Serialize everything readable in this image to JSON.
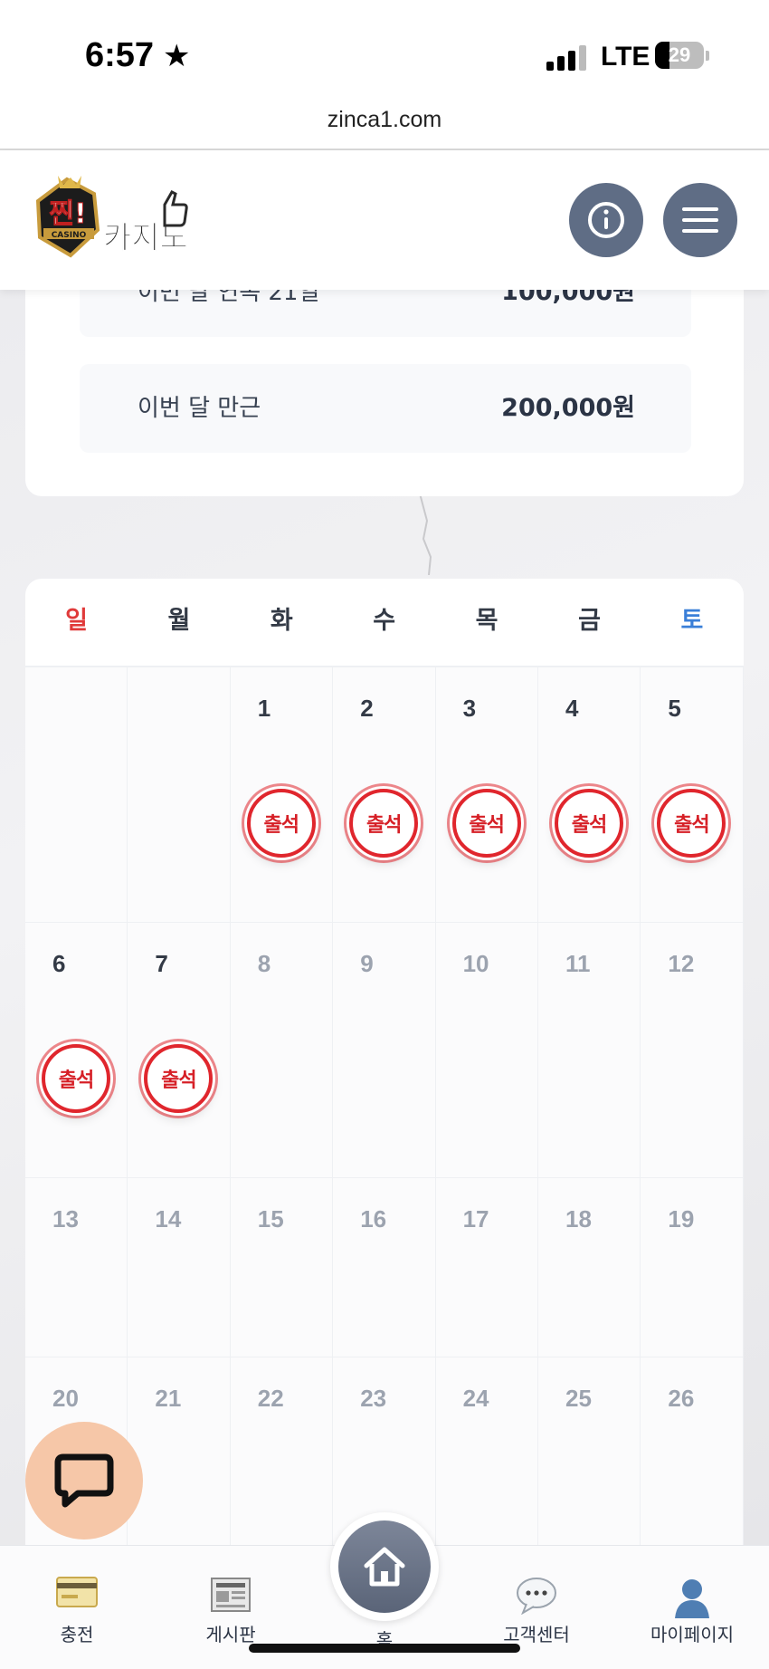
{
  "status_bar": {
    "time": "6:57",
    "carrier": "LTE",
    "battery": "29",
    "battery_level": 0.29
  },
  "browser": {
    "url": "zinca1.com"
  },
  "header": {
    "logo_text_top": "찐!",
    "logo_text_main": "카지노",
    "logo_badge": "CASINO",
    "info_icon": "info-circle-icon",
    "menu_icon": "hamburger-menu-icon"
  },
  "summary": {
    "rows": [
      {
        "label": "이번 달 연속 21일",
        "value": "100,000원"
      },
      {
        "label": "이번 달 만근",
        "value": "200,000원"
      }
    ]
  },
  "calendar": {
    "weekdays": [
      "일",
      "월",
      "화",
      "수",
      "목",
      "금",
      "토"
    ],
    "stamp_label": "출석",
    "weeks": [
      [
        null,
        null,
        1,
        2,
        3,
        4,
        5
      ],
      [
        6,
        7,
        8,
        9,
        10,
        11,
        12
      ],
      [
        13,
        14,
        15,
        16,
        17,
        18,
        19
      ],
      [
        20,
        21,
        22,
        23,
        24,
        25,
        26
      ]
    ],
    "attended_days": [
      1,
      2,
      3,
      4,
      5,
      6,
      7
    ],
    "today": 7,
    "colors": {
      "sunday": "#e03a3a",
      "saturday": "#3a7fd8",
      "stamp": "#e0262d"
    }
  },
  "chat_fab": {
    "icon": "chat-bubble-icon"
  },
  "bottom_nav": {
    "items": [
      {
        "label": "충전",
        "icon": "credit-card-icon"
      },
      {
        "label": "게시판",
        "icon": "newspaper-icon"
      },
      {
        "label": "홈",
        "icon": "home-icon"
      },
      {
        "label": "고객센터",
        "icon": "speech-bubble-icon"
      },
      {
        "label": "마이페이지",
        "icon": "user-silhouette-icon"
      }
    ]
  }
}
